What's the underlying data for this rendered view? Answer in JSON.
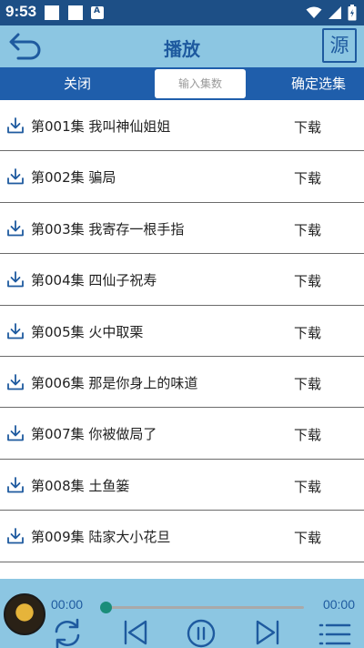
{
  "status_bar": {
    "time": "9:53"
  },
  "header": {
    "title": "播放",
    "source_button": "源"
  },
  "tabs": {
    "close_label": "关闭",
    "input_placeholder": "输入集数",
    "confirm_label": "确定选集"
  },
  "episodes": [
    {
      "title": "第001集 我叫神仙姐姐",
      "action": "下载"
    },
    {
      "title": "第002集 骗局",
      "action": "下载"
    },
    {
      "title": "第003集 我寄存一根手指",
      "action": "下载"
    },
    {
      "title": "第004集 四仙子祝寿",
      "action": "下载"
    },
    {
      "title": "第005集 火中取栗",
      "action": "下载"
    },
    {
      "title": "第006集 那是你身上的味道",
      "action": "下载"
    },
    {
      "title": "第007集 你被做局了",
      "action": "下载"
    },
    {
      "title": "第008集 土鱼篓",
      "action": "下载"
    },
    {
      "title": "第009集 陆家大小花旦",
      "action": "下载"
    }
  ],
  "player": {
    "current_time": "00:00",
    "total_time": "00:00",
    "progress": 0
  },
  "colors": {
    "status_bar": "#1d4f86",
    "title_bar": "#8cc6e2",
    "tab_bar": "#1f5eab",
    "accent": "#1e5a9f",
    "progress_knob": "#1a8d7a"
  }
}
